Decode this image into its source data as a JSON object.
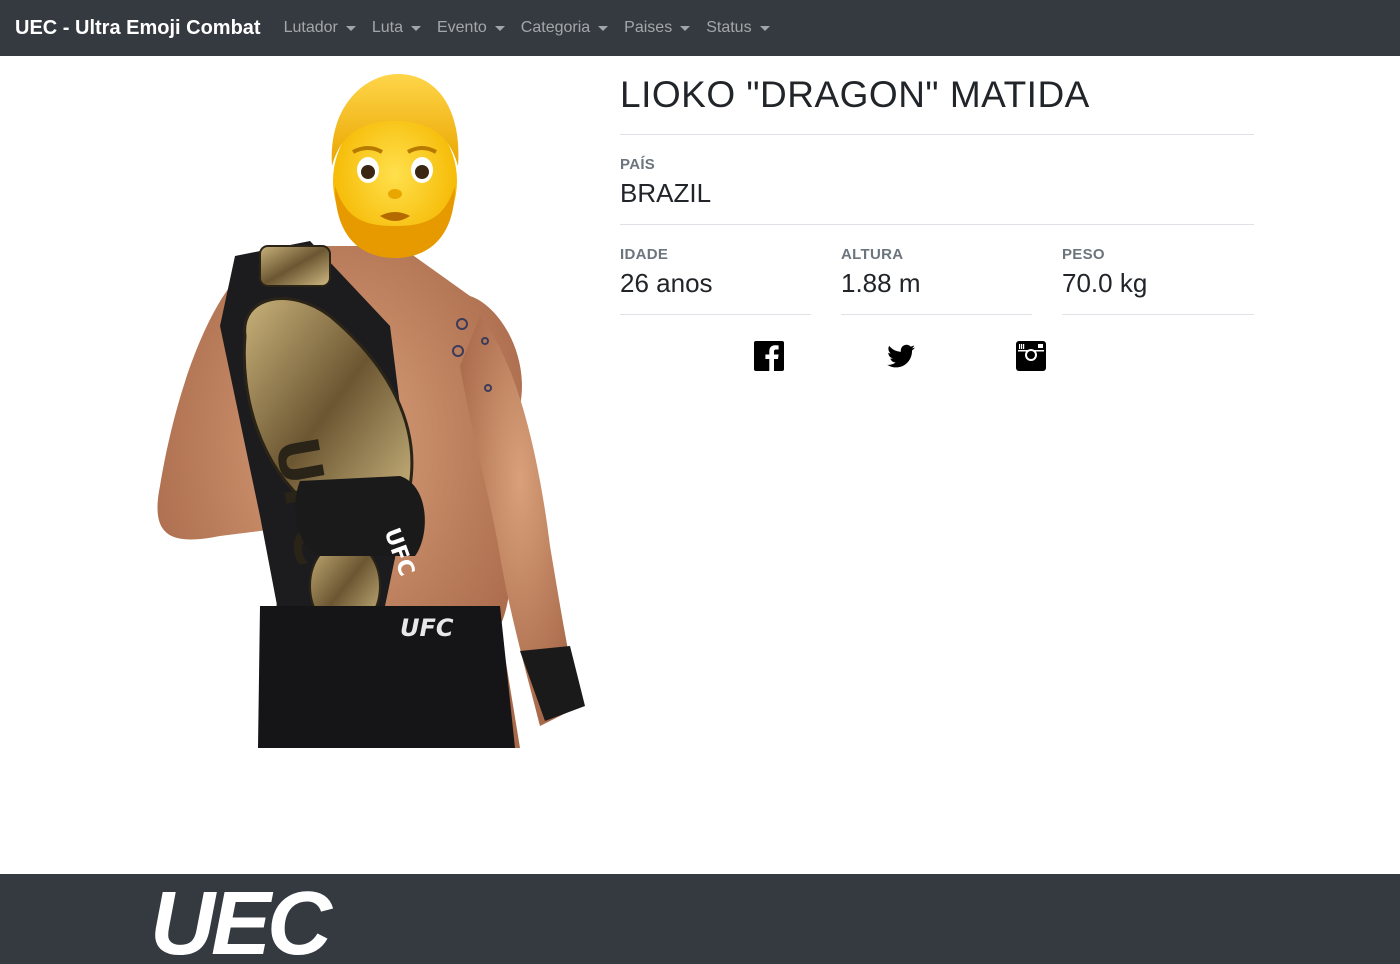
{
  "navbar": {
    "brand": "UEC - Ultra Emoji Combat",
    "items": [
      {
        "label": "Lutador"
      },
      {
        "label": "Luta"
      },
      {
        "label": "Evento"
      },
      {
        "label": "Categoria"
      },
      {
        "label": "Paises"
      },
      {
        "label": "Status"
      }
    ]
  },
  "fighter": {
    "name": "LIOKO \"DRAGON\" MATIDA",
    "country_label": "PAÍS",
    "country": "BRAZIL",
    "stats": [
      {
        "label": "IDADE",
        "value": "26 anos"
      },
      {
        "label": "ALTURA",
        "value": "1.88 m"
      },
      {
        "label": "PESO",
        "value": "70.0 kg"
      }
    ],
    "image_icon": "fighter-with-emoji-face",
    "belt_text": "UFC",
    "shorts_text": "UFC",
    "glove_text": "UFC"
  },
  "social": [
    {
      "icon": "facebook-icon"
    },
    {
      "icon": "twitter-icon"
    },
    {
      "icon": "instagram-icon"
    }
  ],
  "footer": {
    "logo_text": "UEC"
  },
  "colors": {
    "navbar_bg": "#343a40",
    "footer_bg": "#343a40",
    "label_gray": "#6c757d",
    "text_dark": "#212529",
    "divider": "#dee2e6"
  }
}
